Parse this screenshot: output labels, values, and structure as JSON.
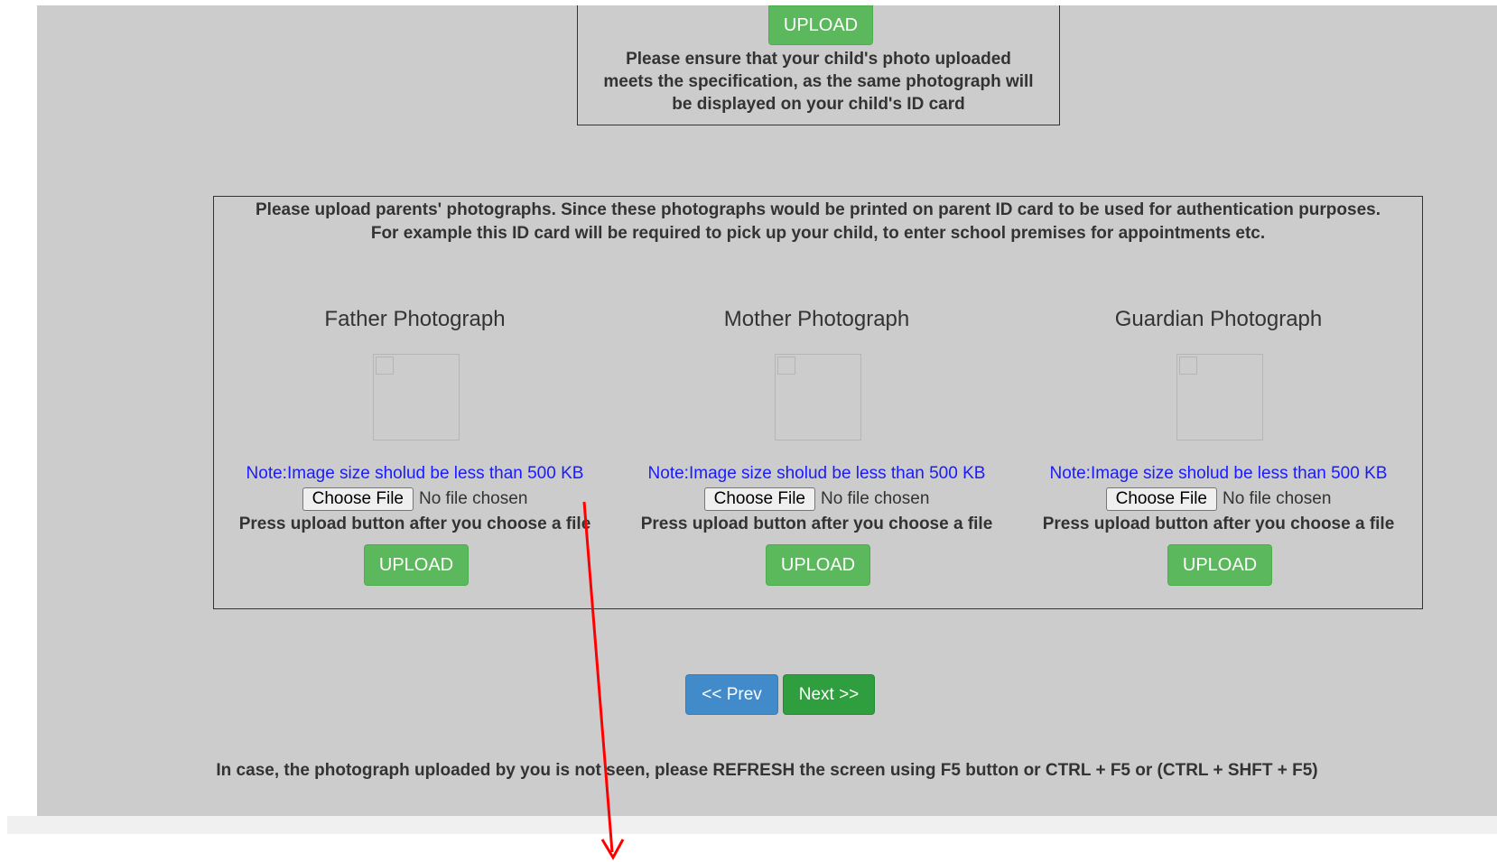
{
  "child_section": {
    "upload_label": "UPLOAD",
    "note_line1": "Please ensure that your child's photo uploaded",
    "note_line2": "meets the specification, as the same photograph will",
    "note_line3": "be displayed on your child's ID card"
  },
  "parents_section": {
    "intro_line1": "Please upload parents' photographs. Since these photographs would be printed on parent ID card to be used for authentication purposes.",
    "intro_line2": "For example this ID card will be required to pick up your child, to enter school premises for appointments etc.",
    "columns": [
      {
        "title": "Father Photograph",
        "note": "Note:Image size sholud be less than 500 KB",
        "choose_label": "Choose File",
        "file_status": "No file chosen",
        "help": "Press upload button after you choose a file",
        "upload_label": "UPLOAD"
      },
      {
        "title": "Mother Photograph",
        "note": "Note:Image size sholud be less than 500 KB",
        "choose_label": "Choose File",
        "file_status": "No file chosen",
        "help": "Press upload button after you choose a file",
        "upload_label": "UPLOAD"
      },
      {
        "title": "Guardian Photograph",
        "note": "Note:Image size sholud be less than 500 KB",
        "choose_label": "Choose File",
        "file_status": "No file chosen",
        "help": "Press upload button after you choose a file",
        "upload_label": "UPLOAD"
      }
    ]
  },
  "nav": {
    "prev_label": "<< Prev",
    "next_label": "Next >>"
  },
  "refresh_note": "In case, the photograph uploaded by you is not seen, please REFRESH the screen using F5 button or CTRL + F5 or (CTRL + SHFT + F5)",
  "colors": {
    "panel_bg": "#cccccc",
    "upload_green": "#5cb85c",
    "next_green": "#2e9e3e",
    "prev_blue": "#428bca",
    "note_blue": "#1a1aff",
    "annotation_arrow": "#ff0000"
  }
}
